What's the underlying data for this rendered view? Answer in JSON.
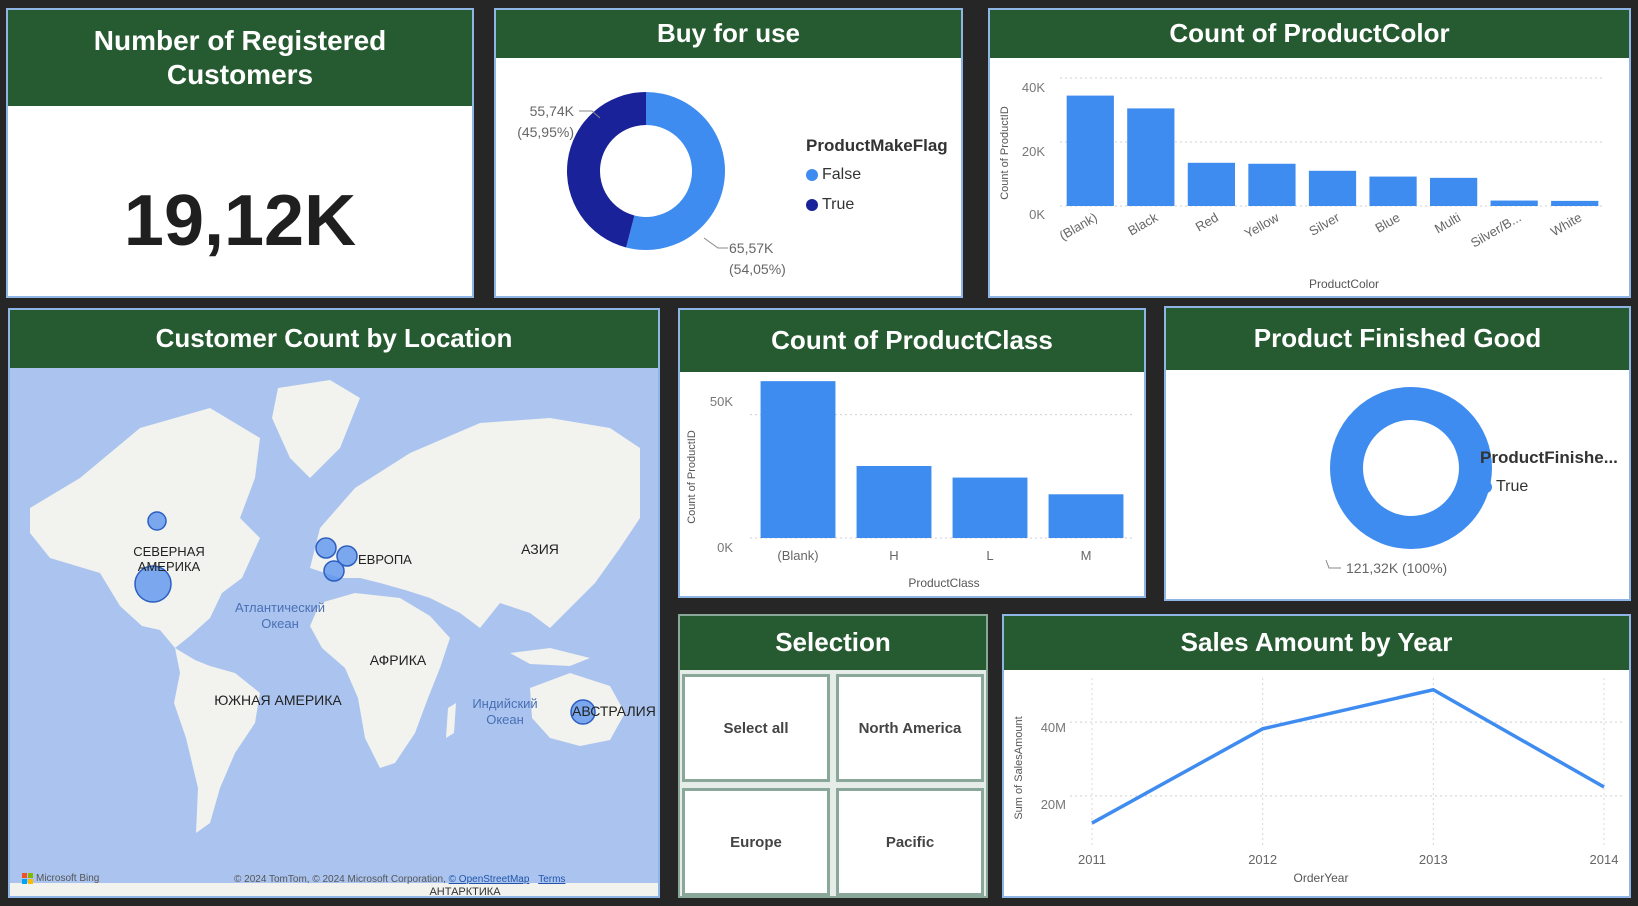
{
  "colors": {
    "header": "#265a30",
    "accent": "#3f8cf0",
    "dark": "#1a2299",
    "map_water": "#aac4ef",
    "map_land": "#f2f2ee"
  },
  "kpi_card": {
    "title": "Number of Registered Customers",
    "value": "19,12K"
  },
  "buy_for_use": {
    "title": "Buy for use",
    "legend_title": "ProductMakeFlag",
    "legend": [
      "False",
      "True"
    ],
    "label_true_value": "55,74K",
    "label_true_pct": "(45,95%)",
    "label_false_value": "65,57K",
    "label_false_pct": "(54,05%)"
  },
  "product_color": {
    "title": "Count of ProductColor",
    "xlabel": "ProductColor",
    "ylabel": "Count of ProductID",
    "yticks": [
      "40K",
      "20K",
      "0K"
    ]
  },
  "location_map": {
    "title": "Customer Count by Location",
    "labels": [
      "СЕВЕРНАЯ",
      "АМЕРИКА",
      "ЕВРОПА",
      "АЗИЯ",
      "АФРИКА",
      "ЮЖНАЯ АМЕРИКА",
      "АВСТРАЛИЯ",
      "Атлантический",
      "Океан",
      "Индийский",
      "Океан",
      "АНТАРКТИКА"
    ],
    "brand": "Microsoft Bing",
    "attribution": "© 2024 TomTom, © 2024 Microsoft Corporation,",
    "osm": "© OpenStreetMap",
    "terms": "Terms"
  },
  "product_class": {
    "title": "Count of ProductClass",
    "xlabel": "ProductClass",
    "ylabel": "Count of ProductID",
    "yticks": [
      "50K",
      "0K"
    ]
  },
  "finished_good": {
    "title": "Product Finished Good",
    "legend_title": "ProductFinishe...",
    "legend": [
      "True"
    ],
    "label": "121,32K (100%)"
  },
  "selection": {
    "title": "Selection",
    "options": [
      "Select all",
      "North America",
      "Europe",
      "Pacific"
    ]
  },
  "sales_by_year": {
    "title": "Sales Amount by Year",
    "xlabel": "OrderYear",
    "ylabel": "Sum of SalesAmount",
    "yticks": [
      "40M",
      "20M"
    ]
  },
  "chart_data": [
    {
      "type": "pie",
      "title": "Buy for use",
      "categories": [
        "False",
        "True"
      ],
      "values": [
        65570,
        55740
      ],
      "legend_title": "ProductMakeFlag",
      "donut": true
    },
    {
      "type": "bar",
      "title": "Count of ProductColor",
      "categories": [
        "(Blank)",
        "Black",
        "Red",
        "Yellow",
        "Silver",
        "Blue",
        "Multi",
        "Silver/B...",
        "White"
      ],
      "values": [
        34500,
        30500,
        13500,
        13200,
        11000,
        9200,
        8800,
        1700,
        1600
      ],
      "xlabel": "ProductColor",
      "ylabel": "Count of ProductID",
      "ylim": [
        0,
        40000
      ],
      "grid": true
    },
    {
      "type": "bar",
      "title": "Count of ProductClass",
      "categories": [
        "(Blank)",
        "H",
        "L",
        "M"
      ],
      "values": [
        61000,
        28000,
        23500,
        17000
      ],
      "xlabel": "ProductClass",
      "ylabel": "Count of ProductID",
      "ylim": [
        0,
        63000
      ],
      "grid": true
    },
    {
      "type": "pie",
      "title": "Product Finished Good",
      "categories": [
        "True"
      ],
      "values": [
        121320
      ],
      "legend_title": "ProductFinishe...",
      "donut": true
    },
    {
      "type": "line",
      "title": "Sales Amount by Year",
      "x": [
        "2011",
        "2012",
        "2013",
        "2014"
      ],
      "series": [
        {
          "values": [
            12600000,
            38200000,
            48800000,
            22400000
          ]
        }
      ],
      "xlabel": "OrderYear",
      "ylabel": "Sum of SalesAmount",
      "ylim": [
        8000000,
        52000000
      ],
      "grid": true
    }
  ]
}
